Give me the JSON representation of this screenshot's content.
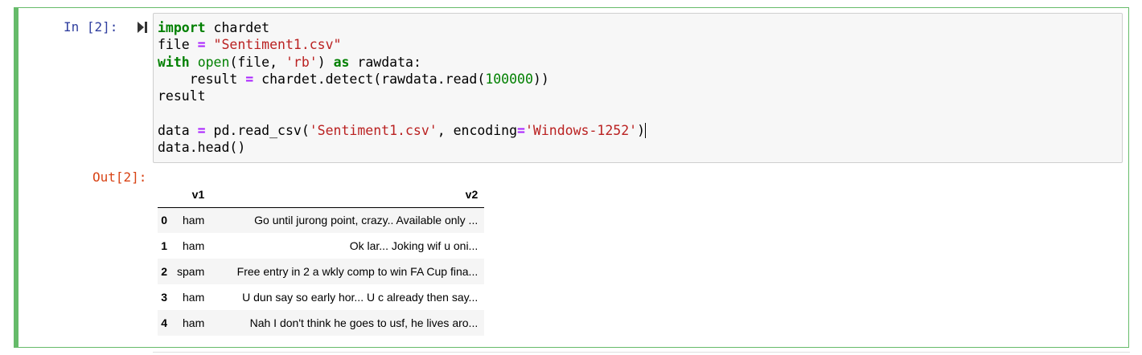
{
  "cell": {
    "in_prompt": "In [2]:",
    "out_prompt": "Out[2]:",
    "run_icon": "run-step-icon"
  },
  "code_lines": [
    [
      {
        "t": "kw",
        "v": "import"
      },
      {
        "t": "",
        "v": " chardet"
      }
    ],
    [
      {
        "t": "",
        "v": "file "
      },
      {
        "t": "op",
        "v": "="
      },
      {
        "t": "",
        "v": " "
      },
      {
        "t": "str",
        "v": "\"Sentiment1.csv\""
      }
    ],
    [
      {
        "t": "kw",
        "v": "with"
      },
      {
        "t": "",
        "v": " "
      },
      {
        "t": "bi",
        "v": "open"
      },
      {
        "t": "",
        "v": "(file, "
      },
      {
        "t": "str",
        "v": "'rb'"
      },
      {
        "t": "",
        "v": ") "
      },
      {
        "t": "kw",
        "v": "as"
      },
      {
        "t": "",
        "v": " rawdata:"
      }
    ],
    [
      {
        "t": "",
        "v": "    result "
      },
      {
        "t": "op",
        "v": "="
      },
      {
        "t": "",
        "v": " chardet.detect(rawdata.read("
      },
      {
        "t": "num",
        "v": "100000"
      },
      {
        "t": "",
        "v": "))"
      }
    ],
    [
      {
        "t": "",
        "v": "result"
      }
    ],
    [
      {
        "t": "",
        "v": ""
      }
    ],
    [
      {
        "t": "",
        "v": "data "
      },
      {
        "t": "op",
        "v": "="
      },
      {
        "t": "",
        "v": " pd.read_csv("
      },
      {
        "t": "str",
        "v": "'Sentiment1.csv'"
      },
      {
        "t": "",
        "v": ", encoding"
      },
      {
        "t": "op",
        "v": "="
      },
      {
        "t": "str",
        "v": "'Windows-1252'"
      },
      {
        "t": "",
        "v": ")"
      },
      {
        "t": "cursor",
        "v": ""
      }
    ],
    [
      {
        "t": "",
        "v": "data.head()"
      }
    ]
  ],
  "colors": {
    "cell_border": "#66bb6a",
    "in_prompt": "#303f9f",
    "out_prompt": "#d84315",
    "keyword": "#008000",
    "operator": "#aa22ff",
    "string": "#ba2121"
  },
  "output_table": {
    "columns": [
      "",
      "v1",
      "v2"
    ],
    "rows": [
      {
        "index": "0",
        "v1": "ham",
        "v2": "Go until jurong point, crazy.. Available only ..."
      },
      {
        "index": "1",
        "v1": "ham",
        "v2": "Ok lar... Joking wif u oni..."
      },
      {
        "index": "2",
        "v1": "spam",
        "v2": "Free entry in 2 a wkly comp to win FA Cup fina..."
      },
      {
        "index": "3",
        "v1": "ham",
        "v2": "U dun say so early hor... U c already then say..."
      },
      {
        "index": "4",
        "v1": "ham",
        "v2": "Nah I don't think he goes to usf, he lives aro..."
      }
    ]
  }
}
